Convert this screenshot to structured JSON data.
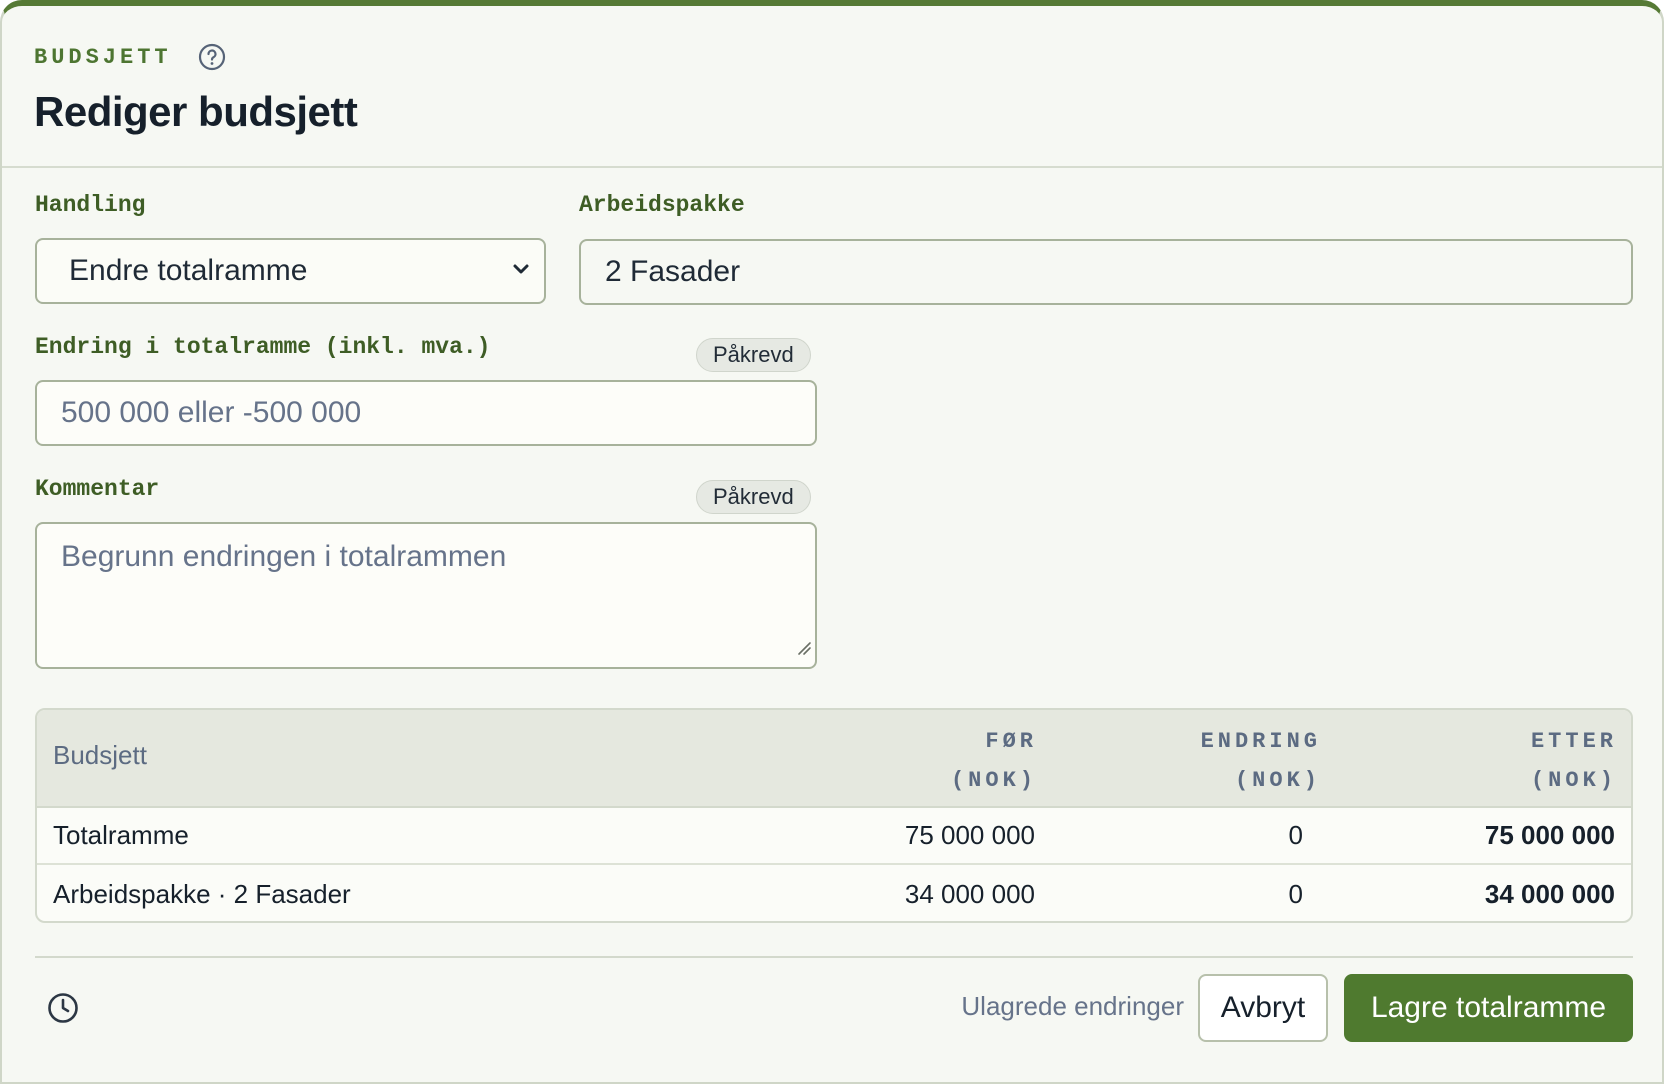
{
  "header": {
    "eyebrow": "BUDSJETT",
    "title": "Rediger budsjett"
  },
  "form": {
    "action": {
      "label": "Handling",
      "selected": "Endre totalramme"
    },
    "work_package": {
      "label": "Arbeidspakke",
      "value": "2 Fasader"
    },
    "change": {
      "label": "Endring i totalramme (inkl. mva.)",
      "badge": "Påkrevd",
      "placeholder": "500 000 eller -500 000"
    },
    "comment": {
      "label": "Kommentar",
      "badge": "Påkrevd",
      "placeholder": "Begrunn endringen i totalrammen"
    }
  },
  "table": {
    "headers": {
      "name": "Budsjett",
      "before": [
        "FØR",
        "(NOK)"
      ],
      "change": [
        "ENDRING",
        "(NOK)"
      ],
      "after": [
        "ETTER",
        "(NOK)"
      ]
    },
    "rows": [
      {
        "name": "Totalramme",
        "before": "75 000 000",
        "change": "0",
        "after": "75 000 000"
      },
      {
        "name": "Arbeidspakke · 2 Fasader",
        "before": "34 000 000",
        "change": "0",
        "after": "34 000 000"
      }
    ]
  },
  "footer": {
    "status": "Ulagrede endringer",
    "cancel_label": "Avbryt",
    "save_label": "Lagre totalramme"
  },
  "colors": {
    "accent": "#567a35",
    "primary_button": "#4f7a2f",
    "label_text": "#3e5d25",
    "muted_text": "#66738a"
  },
  "icons": {
    "help": "help-circle-icon",
    "select": "chevron-down-icon",
    "history": "clock-icon"
  }
}
